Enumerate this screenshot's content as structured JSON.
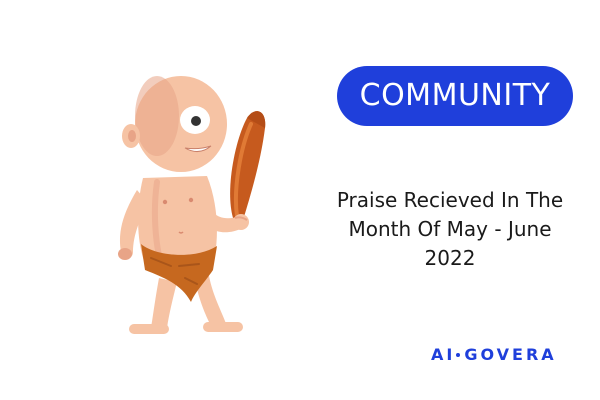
{
  "badge": {
    "label": "COMMUNITY"
  },
  "headline": {
    "lines": [
      "Praise Recieved In The",
      "Month Of May - June",
      "2022"
    ]
  },
  "logo": {
    "part1": "AI",
    "part2": "GOVERA"
  },
  "mascot": {
    "icon": "cyclops-caveman-with-club-icon"
  },
  "colors": {
    "accent": "#1f3fdb",
    "badge_text": "#ffffff",
    "headline_text": "#1a1a1a",
    "background": "#ffffff",
    "skin": "#f6c3a4",
    "skin_shade": "#e8a487",
    "loincloth": "#c6681f",
    "club": "#c65a1e"
  }
}
